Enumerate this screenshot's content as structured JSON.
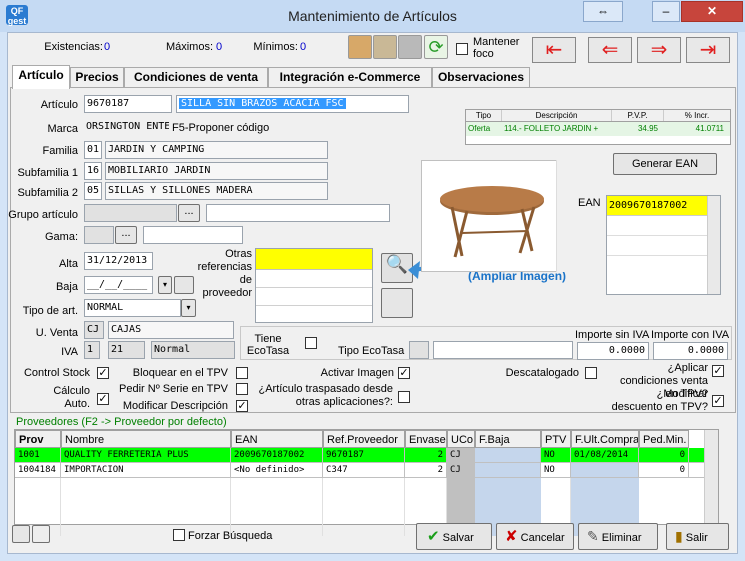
{
  "window": {
    "title": "Mantenimiento de Artículos",
    "app_icon": "QF gest"
  },
  "top": {
    "existencias_label": "Existencias:",
    "existencias": "0",
    "maximos_label": "Máximos:",
    "maximos": "0",
    "minimos_label": "Mínimos:",
    "minimos": "0",
    "mantener_foco": "Mantener foco"
  },
  "tabs": [
    "Artículo",
    "Precios",
    "Condiciones de venta",
    "Integración e-Commerce",
    "Observaciones"
  ],
  "form": {
    "articulo_label": "Artículo",
    "articulo_code": "9670187",
    "articulo_desc": "SILLA SIN BRAZOS ACACIA FSC",
    "marca_label": "Marca",
    "marca": "ORSINGTON ENTE",
    "f5_hint": "F5-Proponer código",
    "familia_label": "Familia",
    "familia_code": "01",
    "familia_desc": "JARDIN Y CAMPING",
    "subfamilia1_label": "Subfamilia 1",
    "subfamilia1_code": "16",
    "subfamilia1_desc": "MOBILIARIO JARDIN",
    "subfamilia2_label": "Subfamilia 2",
    "subfamilia2_code": "05",
    "subfamilia2_desc": "SILLAS Y SILLONES MADERA",
    "grupo_label": "Grupo artículo",
    "gama_label": "Gama:",
    "ellipsis": "...",
    "alta_label": "Alta",
    "alta": "31/12/2013",
    "baja_label": "Baja",
    "baja": "__/__/____",
    "tipo_label": "Tipo de art.",
    "tipo": "NORMAL",
    "uventa_label": "U. Venta",
    "uventa_code": "CJ",
    "uventa_desc": "CAJAS",
    "iva_label": "IVA",
    "iva_code": "1",
    "iva_pct": "21",
    "iva_desc": "Normal",
    "otras_ref_label": "Otras referencias de proveedor",
    "ecotasa_label": "Tiene EcoTasa",
    "tipo_ecotasa_label": "Tipo EcoTasa",
    "importe_sin_label": "Importe sin IVA",
    "importe_sin": "0.0000",
    "importe_con_label": "Importe con IVA",
    "importe_con": "0.0000",
    "ampliar_imagen": "(Ampliar Imagen)"
  },
  "oferta": {
    "headers": [
      "Tipo",
      "Descripción",
      "P.V.P.",
      "% Incr."
    ],
    "row": [
      "Oferta",
      "114.- FOLLETO JARDIN +",
      "34.95",
      "41.0711"
    ]
  },
  "ean": {
    "button": "Generar EAN",
    "label": "EAN",
    "value": "2009670187002"
  },
  "checks": {
    "control_stock": "Control Stock",
    "calculo_auto": "Cálculo Auto.",
    "bloquear_tpv": "Bloquear en el TPV",
    "pedir_serie": "Pedir Nº Serie en TPV",
    "modificar_desc": "Modificar Descripción",
    "activar_imagen": "Activar Imagen",
    "traspasado": "¿Artículo traspasado desde otras aplicaciones?:",
    "descatalogado": "Descatalogado",
    "aplicar_cond": "¿Aplicar condiciones venta en TPV?",
    "modificar_dto": "¿Modificar descuento en TPV?"
  },
  "proveedores": {
    "caption": "Proveedores (F2 -> Proveedor por defecto)",
    "headers": [
      "Prov",
      "Nombre",
      "EAN",
      "Ref.Proveedor",
      "Envase",
      "UCo",
      "F.Baja",
      "PTV",
      "F.Ult.Compra",
      "Ped.Min."
    ],
    "rows": [
      [
        "1001",
        "QUALITY FERRETERIA PLUS",
        "2009670187002",
        "9670187",
        "2",
        "CJ",
        "",
        "NO",
        "01/08/2014",
        "0"
      ],
      [
        "1004184",
        "IMPORTACION",
        "<No definido>",
        "C347",
        "2",
        "CJ",
        "",
        "NO",
        "",
        "0"
      ]
    ]
  },
  "bottom": {
    "forzar": "Forzar Búsqueda",
    "salvar": "Salvar",
    "cancelar": "Cancelar",
    "eliminar": "Eliminar",
    "salir": "Salir"
  },
  "colors": {
    "accent": "#3399ff",
    "offer_green": "#008000",
    "row_green": "#00ff00",
    "ean_yellow": "#ffff00",
    "nav_red": "#e02020",
    "link_blue": "#1a73c8"
  }
}
